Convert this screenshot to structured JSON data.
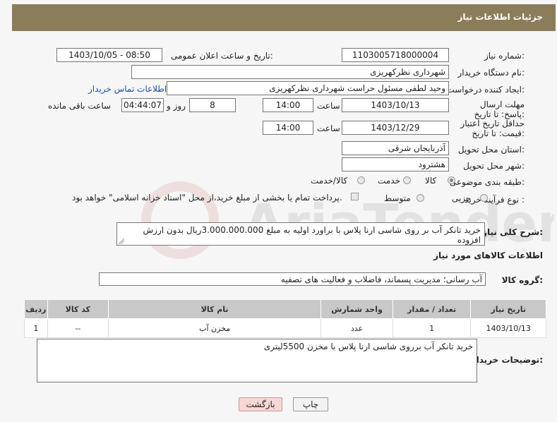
{
  "header": {
    "title": "جزئیات اطلاعات نیاز"
  },
  "fields": {
    "need_number": {
      "label": "شماره نیاز:",
      "value": "1103005718000004"
    },
    "announce_datetime": {
      "label": "تاریخ و ساعت اعلان عمومی:",
      "value": "1403/10/05 - 08:50"
    },
    "buyer_org": {
      "label": "نام دستگاه خریدار:",
      "value": "شهرداری نظرکهریزی"
    },
    "requester": {
      "label": "ایجاد کننده درخواست:",
      "value": "وحید  لطفی مسئول حراست شهرداری نظرکهریزی",
      "contact_link": "اطلاعات تماس خریدار"
    },
    "reply_deadline": {
      "label": "مهلت ارسال پاسخ: تا تاریخ:",
      "date": "1403/10/13",
      "time_label": "ساعت",
      "time": "14:00",
      "days": "8",
      "days_label": "روز و",
      "remaining": "04:44:07",
      "remaining_label": "ساعت باقی مانده"
    },
    "price_validity": {
      "label": "حداقل تاریخ اعتبار قیمت: تا تاریخ:",
      "date": "1403/12/29",
      "time_label": "ساعت",
      "time": "14:00"
    },
    "province": {
      "label": "استان محل تحویل:",
      "value": "آذربایجان شرقی"
    },
    "city": {
      "label": "شهر محل تحویل:",
      "value": "هشترود"
    },
    "category": {
      "label": "طبقه بندی موضوعی:",
      "options": [
        "کالا",
        "خدمت",
        "کالا/خدمت"
      ],
      "selected": "کالا"
    },
    "purchase_type": {
      "label": "نوع فرآیند خرید :",
      "options": [
        "جزیی",
        "متوسط"
      ],
      "payment_note": "پرداخت تمام یا بخشی از مبلغ خرید،از محل \"اسناد خزانه اسلامی\" خواهد بود."
    }
  },
  "summary": {
    "label": "شرح کلی نیاز:",
    "value": "خرید تانکر آب بر روی شاسی ارنا پلاس با براورد اولیه به مبلغ 3.000.000.000ریال بدون ارزش افزوده"
  },
  "goods_section": {
    "title": "اطلاعات کالاهای مورد نیاز"
  },
  "goods_group": {
    "label": "گروه کالا:",
    "value": "آب رسانی؛ مدیریت پسماند، فاضلاب و فعالیت های تصفیه"
  },
  "table": {
    "headers": [
      "ردیف",
      "کد کالا",
      "نام کالا",
      "واحد شمارش",
      "تعداد / مقدار",
      "تاریخ نیاز"
    ],
    "rows": [
      [
        "1",
        "--",
        "مخزن آب",
        "عدد",
        "1",
        "1403/10/13"
      ]
    ]
  },
  "buyer_notes": {
    "label": "توضیحات خریدار:",
    "value": "خرید تانکر آب برروی شاسی ارنا پلاس با مخزن 5500لیتری"
  },
  "buttons": {
    "print": "چاپ",
    "back": "بازگشت"
  },
  "watermark": {
    "text": "AriaTender.neT"
  }
}
